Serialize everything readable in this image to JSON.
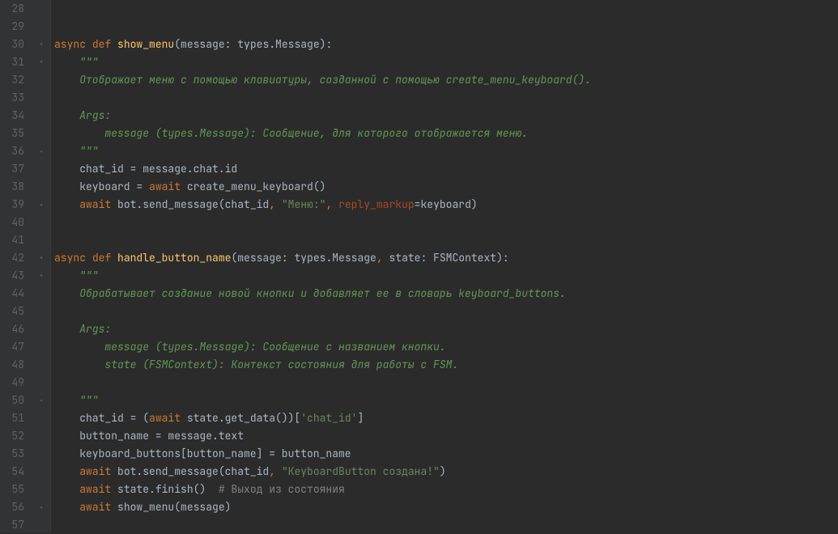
{
  "lines": [
    {
      "num": "28",
      "content": ""
    },
    {
      "num": "29",
      "content": ""
    },
    {
      "num": "30",
      "fold": "↓",
      "tokens": [
        {
          "cls": "kw",
          "text": "async "
        },
        {
          "cls": "def",
          "text": "def "
        },
        {
          "cls": "fn",
          "text": "show_menu"
        },
        {
          "cls": "punct",
          "text": "("
        },
        {
          "cls": "param",
          "text": "message"
        },
        {
          "cls": "punct",
          "text": ": types.Message):"
        }
      ]
    },
    {
      "num": "31",
      "fold": "↓",
      "indent": 1,
      "tokens": [
        {
          "cls": "docstr",
          "text": "\"\"\""
        }
      ]
    },
    {
      "num": "32",
      "indent": 1,
      "tokens": [
        {
          "cls": "docstr",
          "text": "Отображает меню с помощью клавиатуры, созданной с помощью create_menu_keyboard()."
        }
      ]
    },
    {
      "num": "33",
      "content": ""
    },
    {
      "num": "34",
      "indent": 1,
      "tokens": [
        {
          "cls": "docstr",
          "text": "Args:"
        }
      ]
    },
    {
      "num": "35",
      "indent": 2,
      "tokens": [
        {
          "cls": "docstr",
          "text": "message (types.Message): Сообщение, для которого отображается меню."
        }
      ]
    },
    {
      "num": "36",
      "fold": "↑",
      "indent": 1,
      "tokens": [
        {
          "cls": "docstr",
          "text": "\"\"\""
        }
      ]
    },
    {
      "num": "37",
      "indent": 1,
      "tokens": [
        {
          "cls": "var",
          "text": "chat_id = message.chat.id"
        }
      ]
    },
    {
      "num": "38",
      "indent": 1,
      "tokens": [
        {
          "cls": "var",
          "text": "keyboard = "
        },
        {
          "cls": "kw",
          "text": "await"
        },
        {
          "cls": "var",
          "text": " create_menu_keyboard()"
        }
      ]
    },
    {
      "num": "39",
      "fold": "↑",
      "indent": 1,
      "tokens": [
        {
          "cls": "kw",
          "text": "await"
        },
        {
          "cls": "var",
          "text": " bot.send_message(chat_id"
        },
        {
          "cls": "comma",
          "text": ", "
        },
        {
          "cls": "str",
          "text": "\"Меню:\""
        },
        {
          "cls": "comma",
          "text": ", "
        },
        {
          "cls": "paramname",
          "text": "reply_markup"
        },
        {
          "cls": "var",
          "text": "=keyboard)"
        }
      ]
    },
    {
      "num": "40",
      "content": ""
    },
    {
      "num": "41",
      "content": ""
    },
    {
      "num": "42",
      "fold": "↓",
      "tokens": [
        {
          "cls": "kw",
          "text": "async "
        },
        {
          "cls": "def",
          "text": "def "
        },
        {
          "cls": "fn",
          "text": "handle_button_name"
        },
        {
          "cls": "punct",
          "text": "("
        },
        {
          "cls": "param",
          "text": "message"
        },
        {
          "cls": "punct",
          "text": ": types.Message"
        },
        {
          "cls": "comma",
          "text": ", "
        },
        {
          "cls": "param",
          "text": "state"
        },
        {
          "cls": "punct",
          "text": ": FSMContext):"
        }
      ]
    },
    {
      "num": "43",
      "fold": "↓",
      "indent": 1,
      "tokens": [
        {
          "cls": "docstr",
          "text": "\"\"\""
        }
      ]
    },
    {
      "num": "44",
      "indent": 1,
      "tokens": [
        {
          "cls": "docstr",
          "text": "Обрабатывает создание новой кнопки и добавляет ее в словарь keyboard_buttons."
        }
      ]
    },
    {
      "num": "45",
      "content": ""
    },
    {
      "num": "46",
      "indent": 1,
      "tokens": [
        {
          "cls": "docstr",
          "text": "Args:"
        }
      ]
    },
    {
      "num": "47",
      "indent": 2,
      "tokens": [
        {
          "cls": "docstr",
          "text": "message (types.Message): Сообщение с названием кнопки."
        }
      ]
    },
    {
      "num": "48",
      "indent": 2,
      "tokens": [
        {
          "cls": "docstr",
          "text": "state (FSMContext): Контекст состояния для работы с FSM."
        }
      ]
    },
    {
      "num": "49",
      "content": ""
    },
    {
      "num": "50",
      "fold": "↑",
      "indent": 1,
      "tokens": [
        {
          "cls": "docstr",
          "text": "\"\"\""
        }
      ]
    },
    {
      "num": "51",
      "indent": 1,
      "tokens": [
        {
          "cls": "var",
          "text": "chat_id = ("
        },
        {
          "cls": "kw",
          "text": "await"
        },
        {
          "cls": "var",
          "text": " state.get_data())["
        },
        {
          "cls": "str",
          "text": "'chat_id'"
        },
        {
          "cls": "var",
          "text": "]"
        }
      ]
    },
    {
      "num": "52",
      "indent": 1,
      "tokens": [
        {
          "cls": "var",
          "text": "button_name = message.text"
        }
      ]
    },
    {
      "num": "53",
      "indent": 1,
      "tokens": [
        {
          "cls": "var",
          "text": "keyboard_buttons[button_name] = button_name"
        }
      ]
    },
    {
      "num": "54",
      "indent": 1,
      "tokens": [
        {
          "cls": "kw",
          "text": "await"
        },
        {
          "cls": "var",
          "text": " bot.send_message(chat_id"
        },
        {
          "cls": "comma",
          "text": ", "
        },
        {
          "cls": "str",
          "text": "\"KeyboardButton создана!\""
        },
        {
          "cls": "var",
          "text": ")"
        }
      ]
    },
    {
      "num": "55",
      "indent": 1,
      "tokens": [
        {
          "cls": "kw",
          "text": "await"
        },
        {
          "cls": "var",
          "text": " state.finish()  "
        },
        {
          "cls": "comment",
          "text": "# Выход из состояния"
        }
      ]
    },
    {
      "num": "56",
      "fold": "↑",
      "indent": 1,
      "tokens": [
        {
          "cls": "kw",
          "text": "await"
        },
        {
          "cls": "var",
          "text": " show_menu(message)"
        }
      ]
    },
    {
      "num": "57",
      "content": ""
    }
  ],
  "indentSize": "    "
}
